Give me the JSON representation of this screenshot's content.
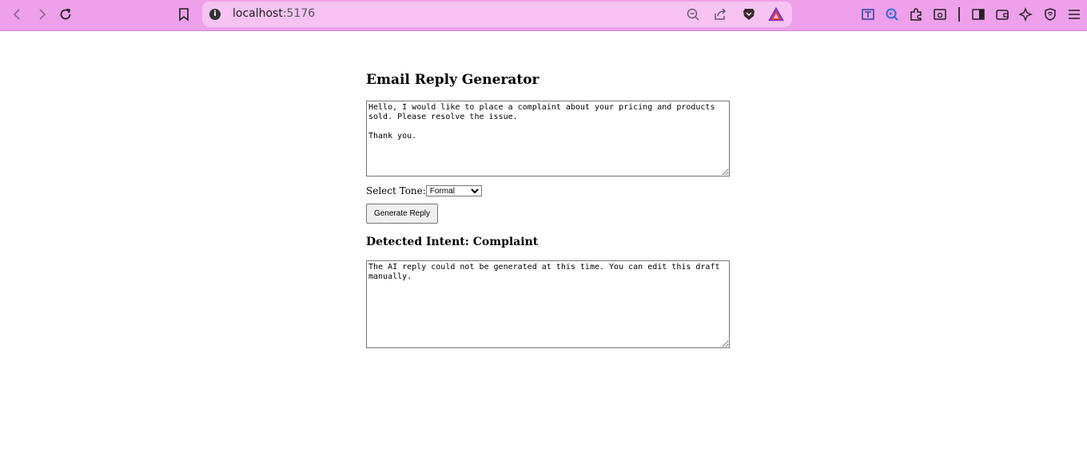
{
  "browser": {
    "url_host": "localhost",
    "url_port": ":5176"
  },
  "app": {
    "title": "Email Reply Generator",
    "email_input_value": "Hello, I would like to place a complaint about your pricing and products sold. Please resolve the issue.\n\nThank you.",
    "tone_label": "Select Tone:",
    "tone_selected": "Formal",
    "generate_button_label": "Generate Reply",
    "intent_heading": "Detected Intent: Complaint",
    "reply_output_value": "The AI reply could not be generated at this time. You can edit this draft manually."
  }
}
